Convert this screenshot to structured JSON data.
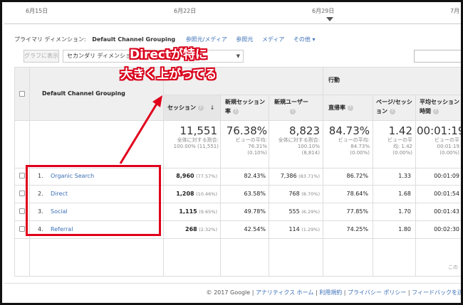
{
  "timeline": {
    "dates": [
      "6月15日",
      "6月22日",
      "6月29日",
      "7月"
    ]
  },
  "dimension_bar": {
    "label": "プライマリ ディメンション:",
    "selected": "Default Channel Grouping",
    "links": [
      "参照元/メディア",
      "参照元",
      "メディア",
      "その他 ▾"
    ]
  },
  "controls": {
    "plot_button": "グラフに表示",
    "secondary_dimension": "セカンダリ ディメンション"
  },
  "table": {
    "dimension_header": "Default Channel Grouping",
    "group_header": "行動",
    "columns": [
      {
        "label": "セッション",
        "help": "?"
      },
      {
        "label": "新規セッション率",
        "help": "?"
      },
      {
        "label": "新規ユーザー",
        "help": "?"
      },
      {
        "label": "直帰率",
        "help": "?"
      },
      {
        "label": "ページ/セッション",
        "help": "?"
      },
      {
        "label": "平均セッション時間",
        "help": "?"
      }
    ],
    "totals": [
      {
        "value": "11,551",
        "sub1": "全体に対する割合:",
        "sub2": "100.00% (11,551)"
      },
      {
        "value": "76.38%",
        "sub1": "ビューの平均:",
        "sub2": "76.31%",
        "sub3": "(0.10%)"
      },
      {
        "value": "8,823",
        "sub1": "全体に対する割合:",
        "sub2": "100.10%",
        "sub3": "(8,814)"
      },
      {
        "value": "84.73%",
        "sub1": "ビューの平均:",
        "sub2": "84.73%",
        "sub3": "(0.00%)"
      },
      {
        "value": "1.42",
        "sub1": "ビューの平",
        "sub2": "均: 1.42",
        "sub3": "(0.00%)"
      },
      {
        "value": "00:01:19",
        "sub1": "ビューの平",
        "sub2": "00:01:19",
        "sub3": "(0.00%)"
      }
    ],
    "rows": [
      {
        "num": "1.",
        "name": "Organic Search",
        "sessions": "8,960",
        "sessions_pct": "(77.57%)",
        "new_rate": "82.43%",
        "new_users": "7,386",
        "new_users_pct": "(83.71%)",
        "bounce": "86.72%",
        "pages": "1.33",
        "duration": "00:01:09"
      },
      {
        "num": "2.",
        "name": "Direct",
        "sessions": "1,208",
        "sessions_pct": "(10.46%)",
        "new_rate": "63.58%",
        "new_users": "768",
        "new_users_pct": "(8.70%)",
        "bounce": "78.64%",
        "pages": "1.68",
        "duration": "00:01:54"
      },
      {
        "num": "3.",
        "name": "Social",
        "sessions": "1,115",
        "sessions_pct": "(9.65%)",
        "new_rate": "49.78%",
        "new_users": "555",
        "new_users_pct": "(6.29%)",
        "bounce": "77.85%",
        "pages": "1.70",
        "duration": "00:01:43"
      },
      {
        "num": "4.",
        "name": "Referral",
        "sessions": "268",
        "sessions_pct": "(2.32%)",
        "new_rate": "42.54%",
        "new_users": "114",
        "new_users_pct": "(1.29%)",
        "bounce": "74.25%",
        "pages": "1.80",
        "duration": "00:02:30"
      }
    ],
    "sort_arrow": "↓",
    "side_note": "この"
  },
  "annotation": {
    "line1": "Directが特に",
    "line2": "大きく上がってる",
    "color": "#e0001b"
  },
  "footer": {
    "copyright": "© 2017 Google",
    "links": [
      "アナリティクス ホーム",
      "利用規約",
      "プライバシー ポリシー",
      "フィードバックを送"
    ]
  }
}
